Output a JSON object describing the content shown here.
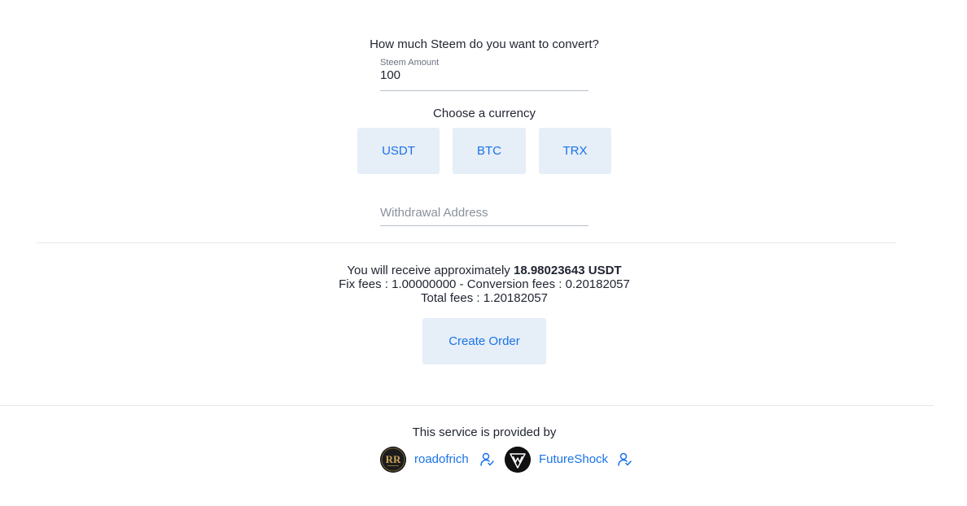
{
  "form": {
    "question": "How much Steem do you want to convert?",
    "amount_label": "Steem Amount",
    "amount_value": "100",
    "currency_prompt": "Choose a currency",
    "currencies": [
      "USDT",
      "BTC",
      "TRX"
    ],
    "address_placeholder": "Withdrawal Address"
  },
  "summary": {
    "receive_prefix": "You will receive approximately",
    "receive_amount": "18.98023643 USDT",
    "fees_line": "Fix fees : 1.00000000 - Conversion fees : 0.20182057",
    "total_fees": "Total fees : 1.20182057",
    "create_button": "Create Order"
  },
  "footer": {
    "provided_by": "This service is provided by",
    "providers": [
      {
        "name": "roadofrich",
        "avatar_icon": "roadofrich-logo-icon",
        "link_icon": "user-icon"
      },
      {
        "name": "FutureShock",
        "avatar_icon": "futureshock-logo-icon",
        "link_icon": "user-icon"
      }
    ]
  },
  "colors": {
    "accent": "#1a73e8",
    "button_bg": "#e6eef7",
    "text": "#1f2430",
    "muted": "#8a919c",
    "divider": "#e5e7eb"
  }
}
